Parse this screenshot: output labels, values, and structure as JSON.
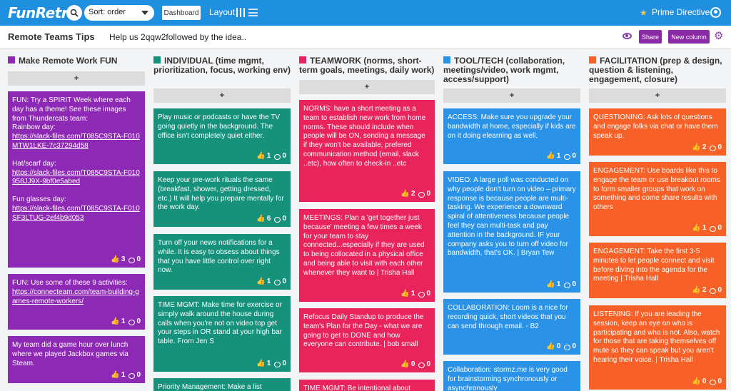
{
  "app": {
    "logo": "FunRetro"
  },
  "topbar": {
    "sort_value": "Sort: order",
    "dashboard_label": "Dashboard",
    "layout_label": "Layout",
    "prime_directive": "Prime Directive",
    "accent_color": "#1f8fe0"
  },
  "board": {
    "title": "Remote Teams Tips",
    "description": "Help us 2qqw2followed by the idea..",
    "share_label": "Share",
    "new_column_label": "New column"
  },
  "add_label": "+",
  "columns": [
    {
      "title": "Make Remote Work FUN",
      "color": "#8e29b5",
      "cards": [
        {
          "text": "FUN: Try a SPIRIT Week where each day has a theme! See these images from Thundercats team:\nRainbow day:",
          "link1": "https://slack-files.com/T085C9STA-F010MTW1LKE-7c37294d58",
          "text2": "Hat/scarf day:",
          "link2": "https://slack-files.com/T085C9STA-F010958JJ9X-9bf0e5abed",
          "text3": "Fun glasses day:",
          "link3": "https://slack-files.com/T085C9STA-F010SF3LTUG-2ef4b9d053",
          "likes": "3",
          "comments": "0"
        },
        {
          "text": "FUN: Use some of these 9 activities:",
          "link1": "https://connecteam.com/team-building-games-remote-workers/",
          "likes": "1",
          "comments": "0"
        },
        {
          "text": "My team did a game hour over lunch where we played Jackbox games via Steam.",
          "likes": "1",
          "comments": "0"
        }
      ]
    },
    {
      "title": "INDIVIDUAL (time mgmt, prioritization, focus, working env)",
      "color": "#16927c",
      "cards": [
        {
          "text": "Play music or podcasts or have the TV going quietly in the background. The office isn't completely quiet either.",
          "likes": "1",
          "comments": "0"
        },
        {
          "text": "Keep your pre-work rituals the same (breakfast, shower, getting dressed, etc.) It will help you prepare mentally for the work day.",
          "likes": "6",
          "comments": "0"
        },
        {
          "text": "Turn off your news notifications for a while. It is easy to obsess about things that you have little control over right now.",
          "likes": "1",
          "comments": "0"
        },
        {
          "text": "TIME MGMT: Make time for exercise or simply walk around the house during calls when you're not on video top get your steps in OR stand at your high bar table. From Jen S",
          "likes": "1",
          "comments": "0"
        },
        {
          "text": "Priority Management: Make a list",
          "likes": "",
          "comments": ""
        }
      ]
    },
    {
      "title": "TEAMWORK (norms, short-term goals, meetings, daily work)",
      "color": "#e9245d",
      "cards": [
        {
          "text": "NORMS: have a short meeting as a team to establish new work from home norms. These should include when people will be ON, sending a message if they won't be available, prefered communication method (email, slack ..etc), how often to check-in ..etc",
          "likes": "2",
          "comments": "0"
        },
        {
          "text": "MEETINGS: Plan a 'get together just because' meeting a few times a week for your team to stay connected...especially if they are used to being collocated in a physical office and being able to visit with each other whenever they want to | Trisha Hall",
          "likes": "1",
          "comments": "0"
        },
        {
          "text": "Refocus Daily Standup to produce the team's Plan for the Day - what we are going to get to DONE and how everyone can contribute. | bob small",
          "likes": "0",
          "comments": "0"
        },
        {
          "text": "TIME MGMT: Be intentional about",
          "likes": "",
          "comments": ""
        }
      ]
    },
    {
      "title": "TOOL/TECH (collaboration, meetings/video, work mgmt, access/support)",
      "color": "#2a93e8",
      "cards": [
        {
          "text": "ACCESS: Make sure you upgrade your bandwidth at home, especially if kids are on it doing elearning as well.",
          "likes": "1",
          "comments": "0"
        },
        {
          "text": "VIDEO: A large poll was conducted on why people don't turn on video – primary response is because people are multi-tasking. We experience a downward spiral of attentiveness because people feel they can multi-task and pay attention in the background. IF your company asks you to turn off video for bandwidth, that's OK. | Bryan Tew",
          "likes": "1",
          "comments": "0"
        },
        {
          "text": "COLLABORATION: Loom is a nice for recording quick, short videos that you can send through email. - B2",
          "likes": "0",
          "comments": "0"
        },
        {
          "text": "Collaboration: stormz.me is very good for brainstorming synchronously or asynchronously",
          "likes": "",
          "comments": ""
        }
      ]
    },
    {
      "title": "FACILITATION (prep & design, question & listening, engagement, closure)",
      "color": "#f76026",
      "cards": [
        {
          "text": "QUESTIONING: Ask lots of questions and engage folks via chat or have them speak up.",
          "likes": "2",
          "comments": "0"
        },
        {
          "text": "ENGAGEMENT: Use boards like this to engage the team or use breakout rooms to form smaller groups that work on something and come share results with others",
          "likes": "1",
          "comments": "0"
        },
        {
          "text": "ENGAGEMENT: Take the first 3-5 minutes to let people connect and visit before diving into the agenda for the meeting | Trisha Hall",
          "likes": "2",
          "comments": "0"
        },
        {
          "text": "LISTENING: If you are leading the session, keep an eye on who is participating and who is not. Also, watch for those that are taking themselves off mute so they can speak but you aren't hearing their voice. | Trisha Hall",
          "likes": "0",
          "comments": "0"
        }
      ]
    }
  ]
}
